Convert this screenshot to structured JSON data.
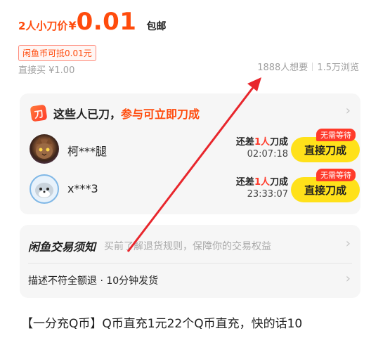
{
  "price": {
    "prefix": "2人小刀价",
    "currency": "¥",
    "value": "0.01",
    "shipping": "包邮"
  },
  "coin_tag": "闲鱼币可抵0.01元",
  "buy_direct": "直接买 ¥1.00",
  "stats": {
    "wants": "1888人想要",
    "views": "1.5万浏览"
  },
  "cut_card": {
    "icon_char": "刀",
    "title": "这些人已刀，",
    "title_accent": "参与可立即刀成",
    "chevron": "›",
    "cutters": [
      {
        "name": "柯***腿",
        "remain_prefix": "还差",
        "remain_num": "1人",
        "remain_suffix": "刀成",
        "timer": "02:07:18",
        "badge": "无需等待",
        "button": "直接刀成"
      },
      {
        "name": "x***3",
        "remain_prefix": "还差",
        "remain_num": "1人",
        "remain_suffix": "刀成",
        "timer": "23:33:07",
        "badge": "无需等待",
        "button": "直接刀成"
      }
    ]
  },
  "rules": {
    "title": "闲鱼交易须知",
    "desc": "买前了解退货规则，保障你的交易权益",
    "guarantee": "描述不符全额退 · 10分钟发货",
    "chevron": "›"
  },
  "description": "【一分充Q币】Q币直充1元22个Q币直充，快的话10"
}
